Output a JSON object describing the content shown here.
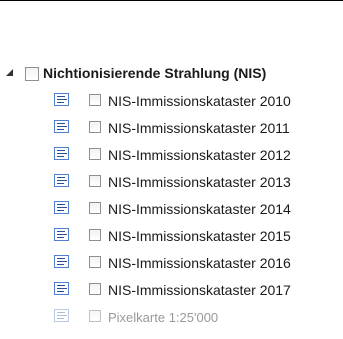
{
  "tree": {
    "group": {
      "label": "Nichtionisierende Strahlung (NIS)",
      "expanded": true,
      "checked": false
    },
    "layers": [
      {
        "label": "NIS-Immissionskataster 2010",
        "checked": false,
        "enabled": true
      },
      {
        "label": "NIS-Immissionskataster 2011",
        "checked": false,
        "enabled": true
      },
      {
        "label": "NIS-Immissionskataster 2012",
        "checked": false,
        "enabled": true
      },
      {
        "label": "NIS-Immissionskataster 2013",
        "checked": false,
        "enabled": true
      },
      {
        "label": "NIS-Immissionskataster 2014",
        "checked": false,
        "enabled": true
      },
      {
        "label": "NIS-Immissionskataster 2015",
        "checked": false,
        "enabled": true
      },
      {
        "label": "NIS-Immissionskataster 2016",
        "checked": false,
        "enabled": true
      },
      {
        "label": "NIS-Immissionskataster 2017",
        "checked": false,
        "enabled": true
      },
      {
        "label": "Pixelkarte 1:25'000",
        "checked": false,
        "enabled": false
      }
    ]
  },
  "colors": {
    "legend_icon_border": "#4f7fcf",
    "legend_icon_lines": "#2d4f8f",
    "disabled_text": "#999999"
  }
}
